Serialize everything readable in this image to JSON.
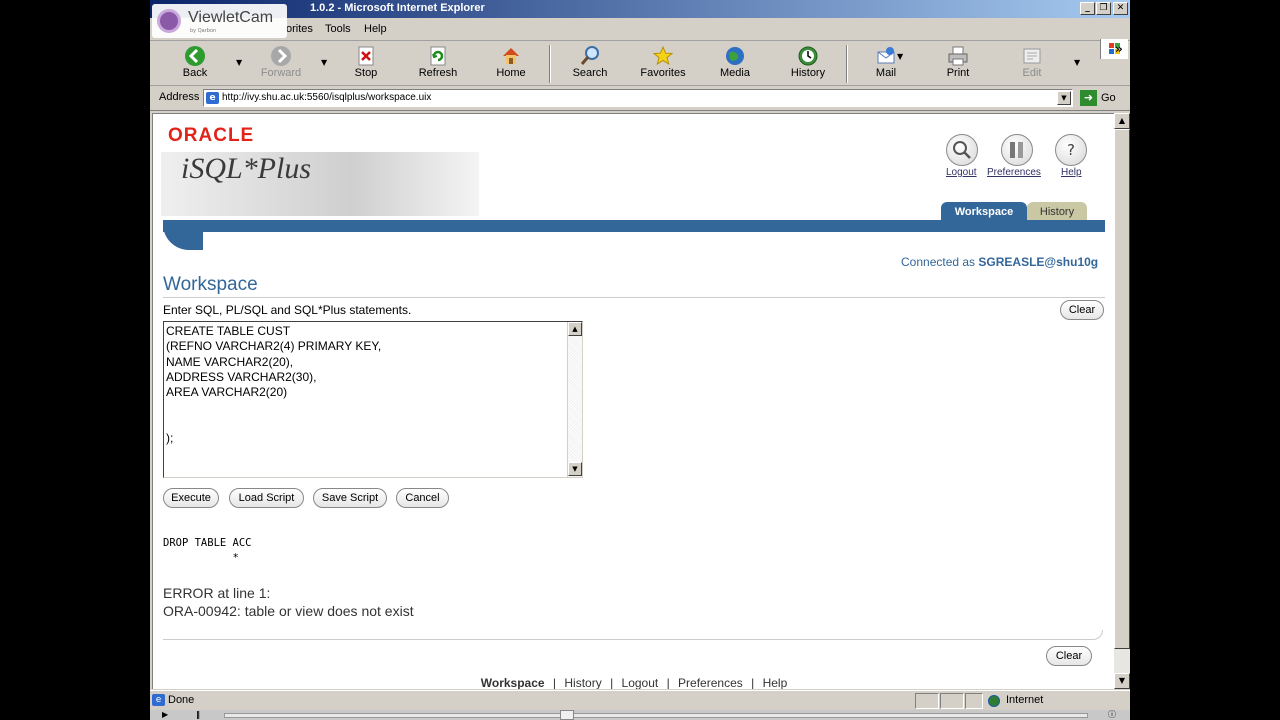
{
  "window": {
    "title": "1.0.2 - Microsoft Internet Explorer",
    "min_btn": "_",
    "max_btn": "❐",
    "close_btn": "✕"
  },
  "overlay": {
    "brand": "ViewletCam",
    "sub": "by Qarbon"
  },
  "menu": {
    "items": [
      "orites",
      "Tools",
      "Help"
    ]
  },
  "toolbar": {
    "back": "Back",
    "forward": "Forward",
    "stop": "Stop",
    "refresh": "Refresh",
    "home": "Home",
    "search": "Search",
    "favorites": "Favorites",
    "media": "Media",
    "history": "History",
    "mail": "Mail",
    "print": "Print",
    "edit": "Edit",
    "chevron": "»"
  },
  "address": {
    "label": "Address",
    "url": "http://ivy.shu.ac.uk:5560/isqlplus/workspace.uix",
    "go": "Go"
  },
  "page": {
    "logo": "ORACLE",
    "product": "iSQL*Plus",
    "header_links": {
      "logout": "Logout",
      "preferences": "Preferences",
      "help": "Help"
    },
    "tabs": {
      "workspace": "Workspace",
      "history": "History"
    },
    "connected_prefix": "Connected as",
    "connected_user": "SGREASLE@shu10g",
    "heading": "Workspace",
    "instructions": "Enter SQL, PL/SQL and SQL*Plus statements.",
    "clear_top": "Clear",
    "sql_input": "CREATE TABLE CUST\n(REFNO VARCHAR2(4) PRIMARY KEY,\nNAME VARCHAR2(20),\nADDRESS VARCHAR2(30),\nAREA VARCHAR2(20)\n\n\n);",
    "buttons": {
      "execute": "Execute",
      "load_script": "Load Script",
      "save_script": "Save Script",
      "cancel": "Cancel"
    },
    "output_statement": "DROP TABLE ACC\n           *",
    "error_line": "ERROR at line 1:",
    "error_message": "ORA-00942: table or view does not exist",
    "clear_bottom": "Clear",
    "footer": {
      "workspace": "Workspace",
      "history": "History",
      "logout": "Logout",
      "preferences": "Preferences",
      "help": "Help",
      "separator": "|"
    }
  },
  "status": {
    "text": "Done",
    "zone": "Internet"
  }
}
